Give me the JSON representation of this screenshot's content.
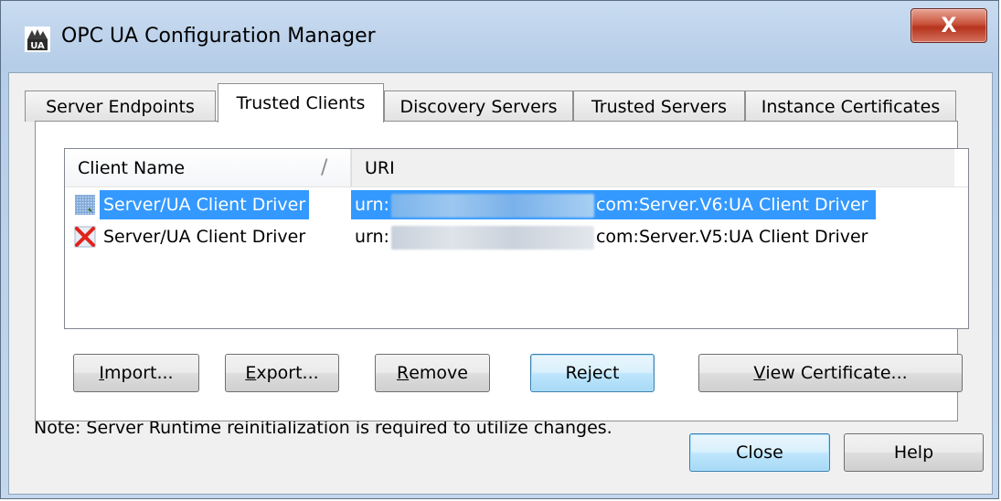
{
  "window": {
    "title": "OPC UA Configuration Manager",
    "close_glyph": "X",
    "icon": "opc-ua-app-icon"
  },
  "tabs": [
    {
      "label": "Server Endpoints",
      "active": false
    },
    {
      "label": "Trusted Clients",
      "active": true
    },
    {
      "label": "Discovery Servers",
      "active": false
    },
    {
      "label": "Trusted Servers",
      "active": false
    },
    {
      "label": "Instance Certificates",
      "active": false
    }
  ],
  "list": {
    "columns": {
      "name": "Client Name",
      "uri": "URI"
    },
    "sort_indicator": "/",
    "rows": [
      {
        "name": "Server/UA Client Driver",
        "uri_prefix": "urn:",
        "uri_suffix": "com:Server.V6:UA Client Driver",
        "status": "trusted",
        "selected": true,
        "icon": "trusted-certificate-icon"
      },
      {
        "name": "Server/UA Client Driver",
        "uri_prefix": "urn:",
        "uri_suffix": "com:Server.V5:UA Client Driver",
        "status": "rejected",
        "selected": false,
        "icon": "rejected-certificate-icon"
      }
    ]
  },
  "buttons": {
    "import": {
      "mnemonic": "I",
      "rest": "mport..."
    },
    "export": {
      "mnemonic": "E",
      "rest": "xport..."
    },
    "remove": {
      "mnemonic": "R",
      "rest": "emove"
    },
    "reject": "Reject",
    "view_certificate": {
      "mnemonic": "V",
      "rest": "iew Certificate..."
    },
    "close": "Close",
    "help": "Help"
  },
  "note": "Note: Server Runtime reinitialization is required to utilize changes.",
  "colors": {
    "selection": "#3399ff",
    "title_gradient": "#b6cde8",
    "close_button": "#c9533c"
  }
}
